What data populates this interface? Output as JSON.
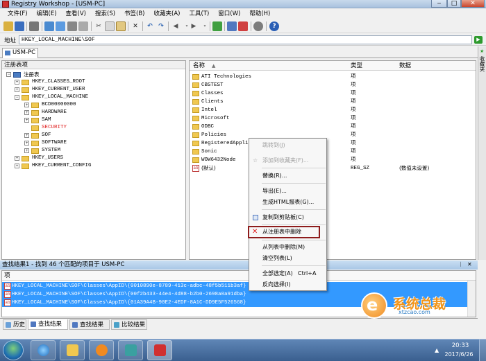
{
  "window": {
    "title": "Registry Workshop - [USM-PC]"
  },
  "menu": [
    "文件(F)",
    "编辑(E)",
    "查看(V)",
    "搜索(S)",
    "书签(B)",
    "收藏夹(A)",
    "工具(T)",
    "窗口(W)",
    "帮助(H)"
  ],
  "address": {
    "label": "地址",
    "value": "HKEY_LOCAL_MACHINE\\SOF"
  },
  "tab": {
    "label": "USM-PC"
  },
  "favorites": {
    "label": "收藏夹"
  },
  "tree": {
    "header": "注册表项",
    "nodes": [
      {
        "label": "注册表",
        "level": 0,
        "exp": "−"
      },
      {
        "label": "HKEY_CLASSES_ROOT",
        "level": 1,
        "exp": "+"
      },
      {
        "label": "HKEY_CURRENT_USER",
        "level": 1,
        "exp": "+"
      },
      {
        "label": "HKEY_LOCAL_MACHINE",
        "level": 1,
        "exp": "−"
      },
      {
        "label": "BCD00000000",
        "level": 2,
        "exp": "+"
      },
      {
        "label": "HARDWARE",
        "level": 2,
        "exp": "+"
      },
      {
        "label": "SAM",
        "level": 2,
        "exp": "+"
      },
      {
        "label": "SECURITY",
        "level": 2,
        "exp": "",
        "highlight": true
      },
      {
        "label": "SOF",
        "level": 2,
        "exp": "+"
      },
      {
        "label": "SOFTWARE",
        "level": 2,
        "exp": "+"
      },
      {
        "label": "SYSTEM",
        "level": 2,
        "exp": "+"
      },
      {
        "label": "HKEY_USERS",
        "level": 1,
        "exp": "+"
      },
      {
        "label": "HKEY_CURRENT_CONFIG",
        "level": 1,
        "exp": "+"
      }
    ]
  },
  "list": {
    "columns": {
      "name": "名称",
      "type": "类型",
      "data": "数据"
    },
    "rows": [
      {
        "name": "ATI Technologies",
        "type": "项",
        "data": "",
        "kind": "folder"
      },
      {
        "name": "CBSTEST",
        "type": "项",
        "data": "",
        "kind": "folder"
      },
      {
        "name": "Classes",
        "type": "项",
        "data": "",
        "kind": "folder"
      },
      {
        "name": "Clients",
        "type": "项",
        "data": "",
        "kind": "folder"
      },
      {
        "name": "Intel",
        "type": "项",
        "data": "",
        "kind": "folder"
      },
      {
        "name": "Microsoft",
        "type": "项",
        "data": "",
        "kind": "folder"
      },
      {
        "name": "ODBC",
        "type": "项",
        "data": "",
        "kind": "folder"
      },
      {
        "name": "Policies",
        "type": "项",
        "data": "",
        "kind": "folder"
      },
      {
        "name": "RegisteredAppli",
        "type": "项",
        "data": "",
        "kind": "folder"
      },
      {
        "name": "Sonic",
        "type": "项",
        "data": "",
        "kind": "folder"
      },
      {
        "name": "WOW6432Node",
        "type": "项",
        "data": "",
        "kind": "folder"
      },
      {
        "name": "(默认)",
        "type": "REG_SZ",
        "data": "(数值未设置)",
        "kind": "value"
      }
    ]
  },
  "context_menu": {
    "items": [
      {
        "label": "跳转到(J)",
        "disabled": true
      },
      {
        "label": "添加到收藏夹(F)...",
        "disabled": true
      },
      {
        "label": "替换(R)..."
      },
      {
        "label": "导出(E)..."
      },
      {
        "label": "生成HTML报表(G)..."
      },
      {
        "label": "复制到剪贴板(C)"
      },
      {
        "label": "从注册表中删除",
        "highlight": true
      },
      {
        "label": "从列表中删除(M)"
      },
      {
        "label": "清空列表(L)"
      },
      {
        "label": "全部选定(A)",
        "shortcut": "Ctrl+A"
      },
      {
        "label": "反向选择(I)"
      }
    ]
  },
  "results": {
    "title": "查找结果1 - 找到 46 个匹配的项目于 USM-PC",
    "column": "项",
    "rows": [
      "HKEY_LOCAL_MACHINE\\SOF\\Classes\\AppID\\{0010890e-8789-413c-adbc-48f5b511b3af}",
      "HKEY_LOCAL_MACHINE\\SOF\\Classes\\AppID\\{00f2b433-44e4-4d88-b2b0-2698a0a91dba}",
      "HKEY_LOCAL_MACHINE\\SOF\\Classes\\AppID\\{01A39A4B-90E2-4EDF-8A1C-DD9E5F526568}"
    ]
  },
  "bottom_tabs": [
    "历史",
    "查找结果 1",
    "查找结果 2",
    "比较结果"
  ],
  "watermark": {
    "text": "系统总裁",
    "url": "xtzcao.com"
  },
  "taskbar": {
    "time": "20:33",
    "date": "2017/6/26"
  },
  "colors": {
    "selection": "#3399ff",
    "highlight_red": "#e02020",
    "title_bar": "#a9c2de"
  }
}
